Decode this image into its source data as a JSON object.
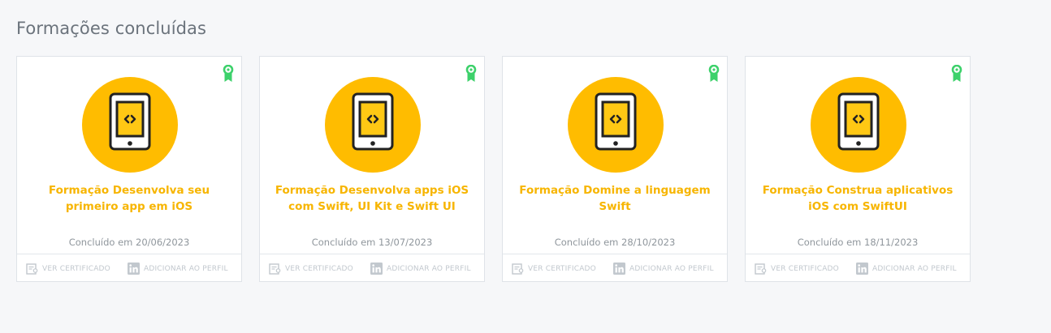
{
  "section": {
    "title": "Formações concluídas"
  },
  "colors": {
    "accent": "#ffbc00",
    "title_text": "#f7b500",
    "badge": "#3dd16b",
    "muted": "#c2c8ce"
  },
  "cards": [
    {
      "title": "Formação Desenvolva seu primeiro app em iOS",
      "completed": "Concluído em 20/06/2023",
      "certificate_label": "VER CERTIFICADO",
      "profile_label": "ADICIONAR AO PERFIL",
      "icon": "phone-code-icon",
      "badge_icon": "award-ribbon-icon"
    },
    {
      "title": "Formação Desenvolva apps iOS com Swift, UI Kit e Swift UI",
      "completed": "Concluído em 13/07/2023",
      "certificate_label": "VER CERTIFICADO",
      "profile_label": "ADICIONAR AO PERFIL",
      "icon": "phone-code-icon",
      "badge_icon": "award-ribbon-icon"
    },
    {
      "title": "Formação Domine a linguagem Swift",
      "completed": "Concluído em 28/10/2023",
      "certificate_label": "VER CERTIFICADO",
      "profile_label": "ADICIONAR AO PERFIL",
      "icon": "phone-code-icon",
      "badge_icon": "award-ribbon-icon"
    },
    {
      "title": "Formação Construa aplicativos iOS com SwiftUI",
      "completed": "Concluído em 18/11/2023",
      "certificate_label": "VER CERTIFICADO",
      "profile_label": "ADICIONAR AO PERFIL",
      "icon": "phone-code-icon",
      "badge_icon": "award-ribbon-icon"
    }
  ]
}
